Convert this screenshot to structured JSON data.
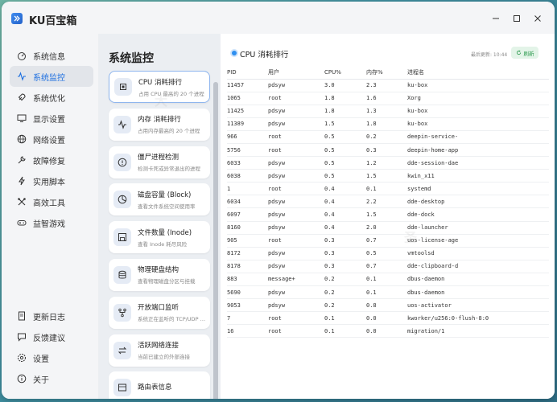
{
  "app": {
    "title": "KU百宝箱"
  },
  "sidebar": {
    "items": [
      {
        "label": "系统信息",
        "icon": "dashboard-icon",
        "active": false
      },
      {
        "label": "系统监控",
        "icon": "pulse-icon",
        "active": true
      },
      {
        "label": "系统优化",
        "icon": "rocket-icon",
        "active": false
      },
      {
        "label": "显示设置",
        "icon": "monitor-icon",
        "active": false
      },
      {
        "label": "网络设置",
        "icon": "globe-icon",
        "active": false
      },
      {
        "label": "故障修复",
        "icon": "wrench-icon",
        "active": false
      },
      {
        "label": "实用脚本",
        "icon": "lightning-icon",
        "active": false
      },
      {
        "label": "高效工具",
        "icon": "tools-icon",
        "active": false
      },
      {
        "label": "益智游戏",
        "icon": "gamepad-icon",
        "active": false
      }
    ],
    "bottom": [
      {
        "label": "更新日志",
        "icon": "document-icon"
      },
      {
        "label": "反馈建议",
        "icon": "chat-icon"
      },
      {
        "label": "设置",
        "icon": "gear-icon"
      },
      {
        "label": "关于",
        "icon": "info-icon"
      }
    ]
  },
  "middle": {
    "title": "系统监控",
    "cards": [
      {
        "title": "CPU 消耗排行",
        "sub": "占用 CPU 最高的 20 个进程",
        "icon": "cpu-icon"
      },
      {
        "title": "内存 消耗排行",
        "sub": "占用内存最高的 20 个进程",
        "icon": "pulse-icon"
      },
      {
        "title": "僵尸进程检测",
        "sub": "检测卡死或异常退出的进程",
        "icon": "alert-icon"
      },
      {
        "title": "磁盘容量 (Block)",
        "sub": "查看文件系统空间使用率",
        "icon": "pie-icon"
      },
      {
        "title": "文件数量 (Inode)",
        "sub": "查看 Inode 耗尽风险",
        "icon": "save-icon"
      },
      {
        "title": "物理硬盘结构",
        "sub": "查看物理磁盘分区与挂载",
        "icon": "database-icon"
      },
      {
        "title": "开放端口监听",
        "sub": "系统正在监听的 TCP/UDP 端口",
        "icon": "branch-icon"
      },
      {
        "title": "活跃网络连接",
        "sub": "当前已建立的外部连接",
        "icon": "swap-icon"
      },
      {
        "title": "路由表信息",
        "sub": "",
        "icon": "route-icon"
      }
    ]
  },
  "content": {
    "section_title": "CPU 消耗排行",
    "last_update": "最后更新: 10:44",
    "refresh_label": "刷新",
    "columns": [
      "PID",
      "用户",
      "CPU%",
      "内存%",
      "进程名"
    ],
    "rows": [
      [
        "11457",
        "pdsyw",
        "3.0",
        "2.3",
        "ku-box"
      ],
      [
        "1065",
        "root",
        "1.8",
        "1.6",
        "Xorg"
      ],
      [
        "11425",
        "pdsyw",
        "1.8",
        "1.3",
        "ku-box"
      ],
      [
        "11389",
        "pdsyw",
        "1.5",
        "1.8",
        "ku-box"
      ],
      [
        "966",
        "root",
        "0.5",
        "0.2",
        "deepin-service-"
      ],
      [
        "5756",
        "root",
        "0.5",
        "0.3",
        "deepin-home-app"
      ],
      [
        "6033",
        "pdsyw",
        "0.5",
        "1.2",
        "dde-session-dae"
      ],
      [
        "6038",
        "pdsyw",
        "0.5",
        "1.5",
        "kwin_x11"
      ],
      [
        "1",
        "root",
        "0.4",
        "0.1",
        "systemd"
      ],
      [
        "6034",
        "pdsyw",
        "0.4",
        "2.2",
        "dde-desktop"
      ],
      [
        "6097",
        "pdsyw",
        "0.4",
        "1.5",
        "dde-dock"
      ],
      [
        "8160",
        "pdsyw",
        "0.4",
        "2.0",
        "dde-launcher"
      ],
      [
        "905",
        "root",
        "0.3",
        "0.7",
        "uos-license-age"
      ],
      [
        "8172",
        "pdsyw",
        "0.3",
        "0.5",
        "vmtoolsd"
      ],
      [
        "8178",
        "pdsyw",
        "0.3",
        "0.7",
        "dde-clipboard-d"
      ],
      [
        "883",
        "message+",
        "0.2",
        "0.1",
        "dbus-daemon"
      ],
      [
        "5690",
        "pdsyw",
        "0.2",
        "0.1",
        "dbus-daemon"
      ],
      [
        "9053",
        "pdsyw",
        "0.2",
        "0.8",
        "uos-activator"
      ],
      [
        "7",
        "root",
        "0.1",
        "0.0",
        "kworker/u256:0-flush-8:0"
      ],
      [
        "16",
        "root",
        "0.1",
        "0.0",
        "migration/1"
      ]
    ]
  },
  "colors": {
    "accent": "#1d6fe0",
    "refresh_green": "#2d9b4f"
  }
}
